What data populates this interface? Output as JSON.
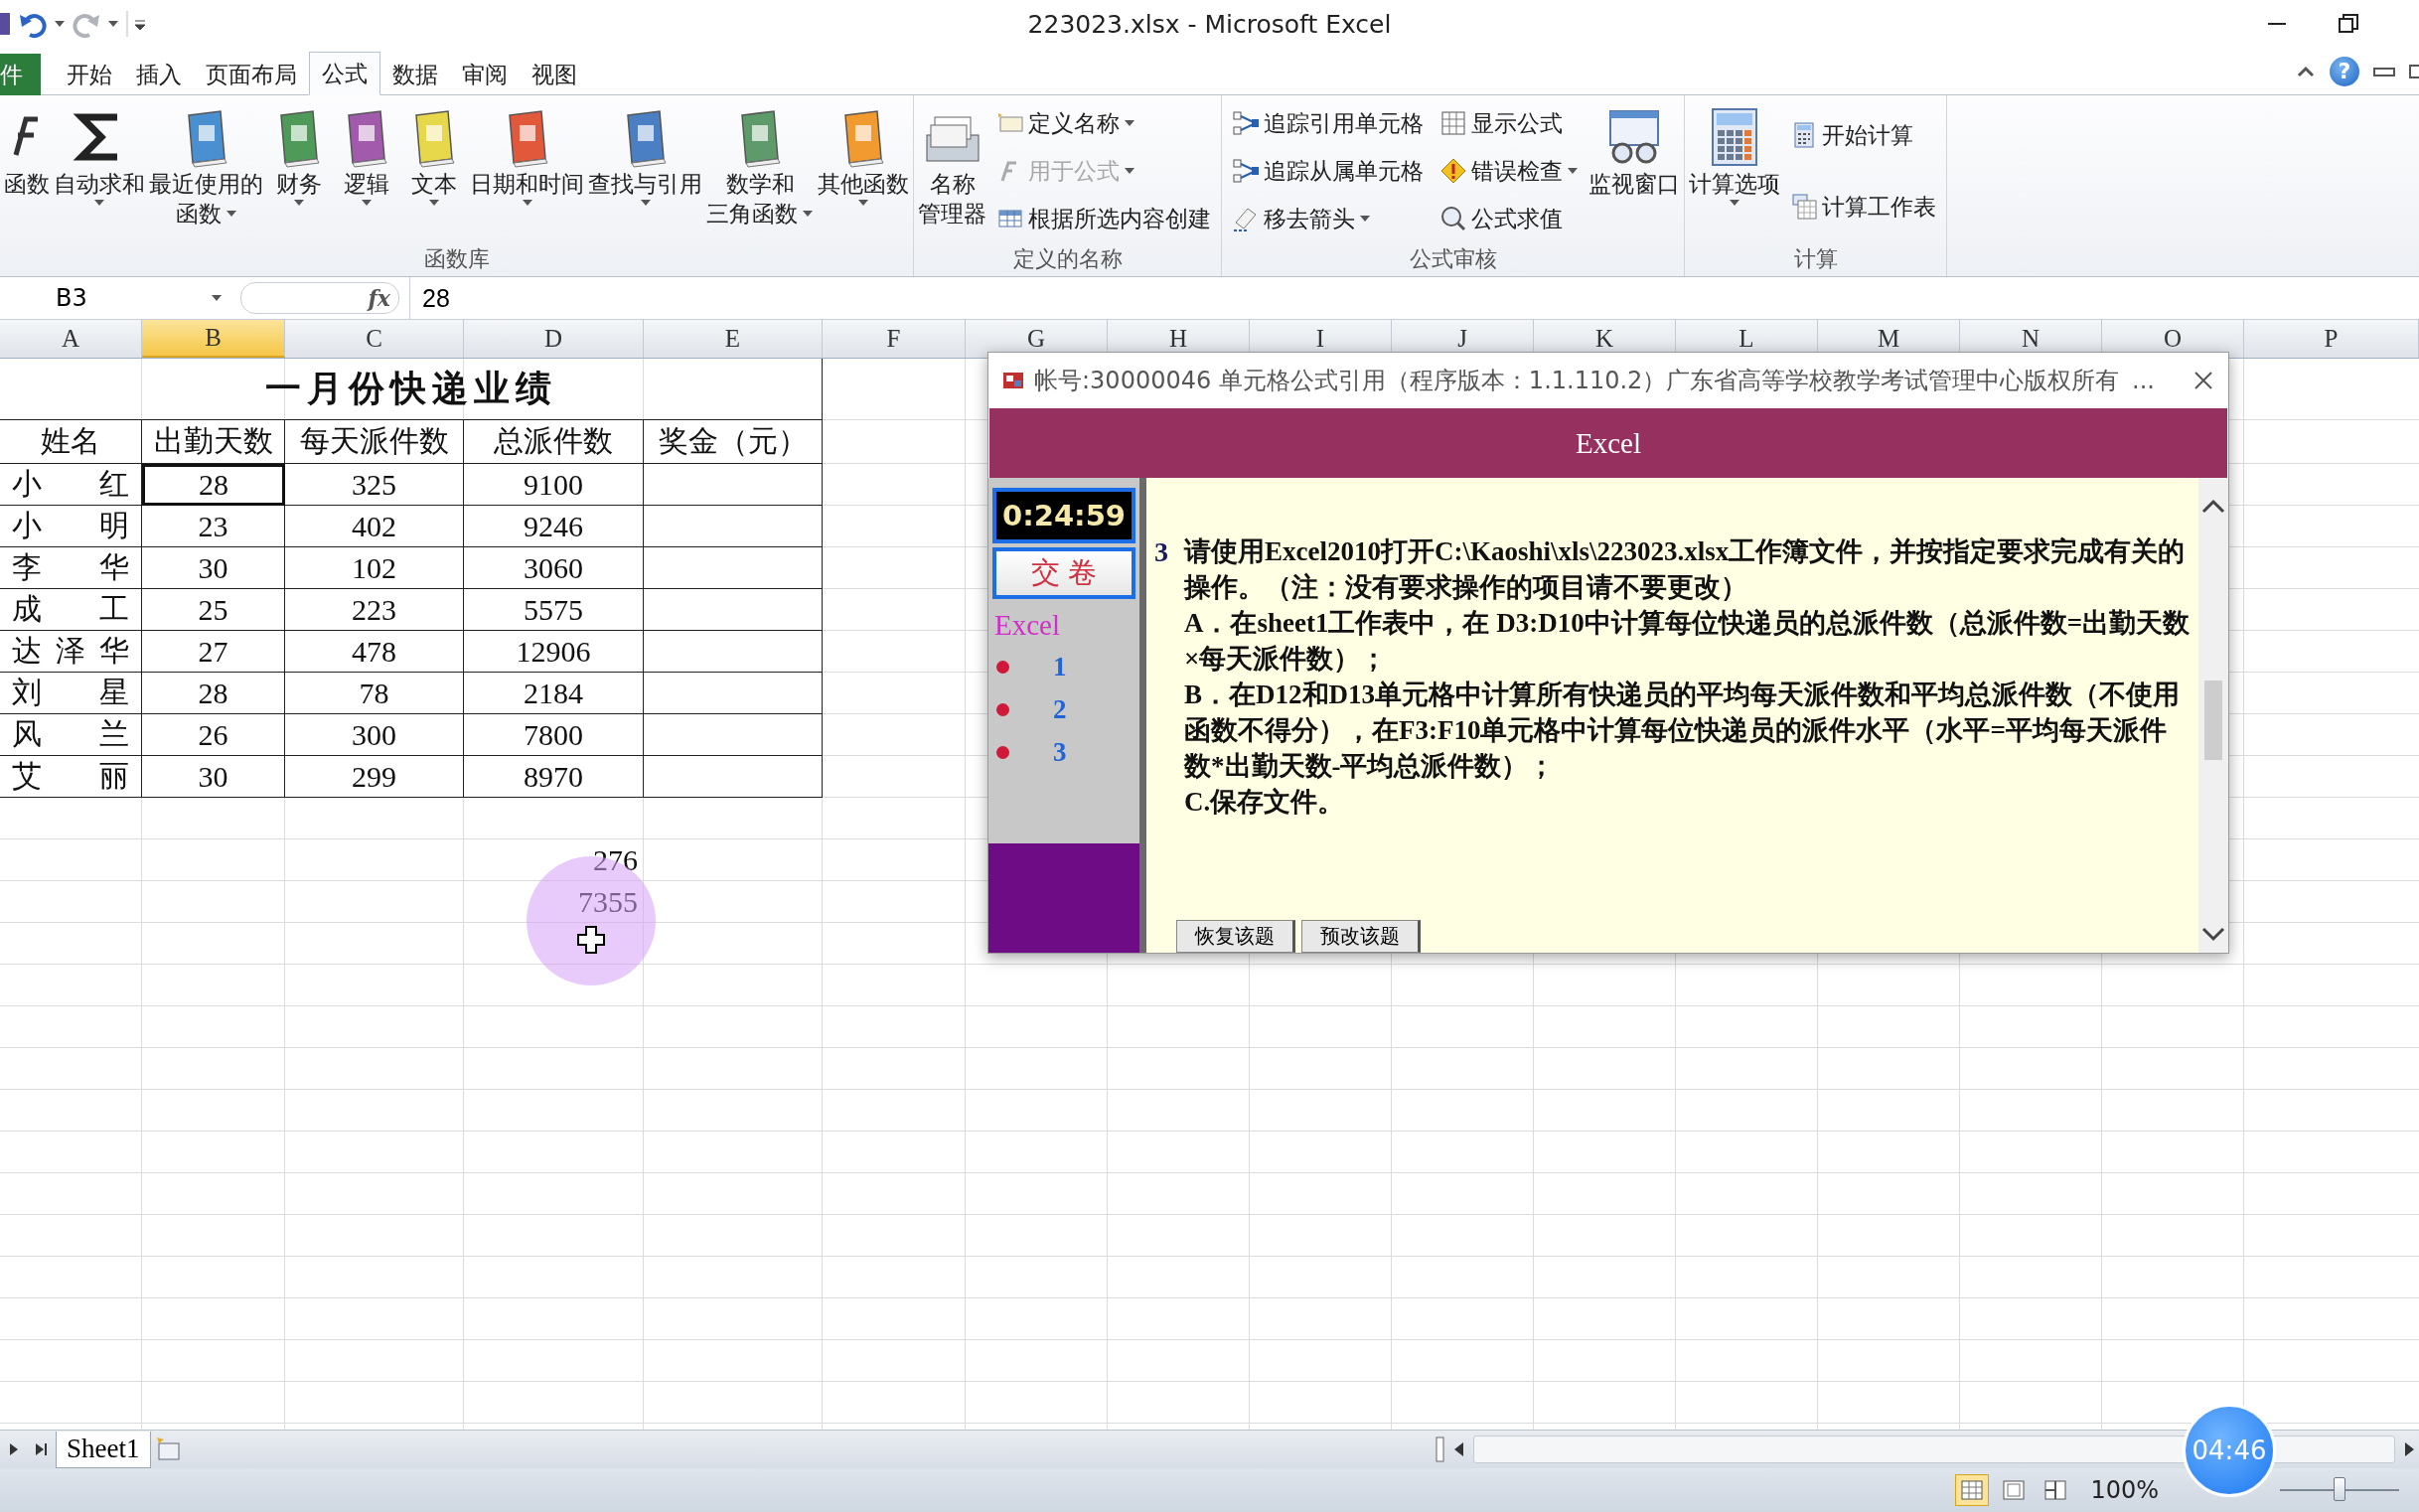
{
  "window": {
    "title": "223023.xlsx - Microsoft Excel",
    "help": "?"
  },
  "tabs": [
    {
      "label": "件",
      "kind": "file",
      "selected": false
    },
    {
      "label": "开始",
      "kind": "tab",
      "selected": false
    },
    {
      "label": "插入",
      "kind": "tab",
      "selected": false
    },
    {
      "label": "页面布局",
      "kind": "tab",
      "selected": false
    },
    {
      "label": "公式",
      "kind": "tab",
      "selected": true
    },
    {
      "label": "数据",
      "kind": "tab",
      "selected": false
    },
    {
      "label": "审阅",
      "kind": "tab",
      "selected": false
    },
    {
      "label": "视图",
      "kind": "tab",
      "selected": false
    }
  ],
  "ribbon": {
    "groups": [
      {
        "label": "函数库",
        "items": [
          {
            "kind": "fx",
            "lines": [
              "函数"
            ],
            "dropdown": false
          },
          {
            "kind": "sigma",
            "lines": [
              "自动求和"
            ],
            "dropdown": true
          },
          {
            "kind": "book",
            "lines": [
              "最近使用的",
              "函数"
            ],
            "color": "#4a8fd0",
            "dropdown": true
          },
          {
            "kind": "book",
            "lines": [
              "财务"
            ],
            "color": "#4f9a58",
            "dropdown": true
          },
          {
            "kind": "book",
            "lines": [
              "逻辑"
            ],
            "color": "#a25aac",
            "dropdown": true
          },
          {
            "kind": "book",
            "lines": [
              "文本"
            ],
            "color": "#e6d84a",
            "dropdown": true
          },
          {
            "kind": "book",
            "lines": [
              "日期和时间"
            ],
            "color": "#e2583a",
            "dropdown": true
          },
          {
            "kind": "book",
            "lines": [
              "查找与引用"
            ],
            "color": "#4a7fc4",
            "dropdown": true
          },
          {
            "kind": "book",
            "lines": [
              "数学和",
              "三角函数"
            ],
            "color": "#5f9a6a",
            "dropdown": true
          },
          {
            "kind": "book",
            "lines": [
              "其他函数"
            ],
            "color": "#f09a30",
            "dropdown": true
          }
        ]
      },
      {
        "label": "定义的名称",
        "items": [
          {
            "kind": "cards",
            "lines": [
              "名称",
              "管理器"
            ],
            "dropdown": false
          },
          {
            "kind": "stack",
            "buttons": [
              {
                "label": "定义名称",
                "kind": "tag",
                "dropdown": true,
                "disabled": false
              },
              {
                "label": "用于公式",
                "kind": "fx",
                "dropdown": true,
                "disabled": true
              },
              {
                "label": "根据所选内容创建",
                "kind": "table",
                "dropdown": false,
                "disabled": false
              }
            ]
          }
        ]
      },
      {
        "label": "公式审核",
        "items": [
          {
            "kind": "stack",
            "buttons": [
              {
                "label": "追踪引用单元格",
                "kind": "trace",
                "dropdown": false,
                "disabled": false
              },
              {
                "label": "追踪从属单元格",
                "kind": "trace",
                "dropdown": false,
                "disabled": false
              },
              {
                "label": "移去箭头",
                "kind": "eraser",
                "dropdown": true,
                "disabled": false
              }
            ]
          },
          {
            "kind": "stack",
            "buttons": [
              {
                "label": "显示公式",
                "kind": "grid",
                "dropdown": false,
                "disabled": false
              },
              {
                "label": "错误检查",
                "kind": "warning",
                "dropdown": true,
                "disabled": false
              },
              {
                "label": "公式求值",
                "kind": "magnifier",
                "dropdown": false,
                "disabled": false
              }
            ]
          },
          {
            "kind": "glasses",
            "lines": [
              "监视窗口"
            ],
            "dropdown": false
          }
        ]
      },
      {
        "label": "计算",
        "items": [
          {
            "kind": "calculator",
            "lines": [
              "计算选项"
            ],
            "dropdown": true
          },
          {
            "kind": "stack",
            "buttons": [
              {
                "label": "开始计算",
                "kind": "calculator",
                "dropdown": false,
                "disabled": false
              },
              {
                "label": "计算工作表",
                "kind": "sheet",
                "dropdown": false,
                "disabled": false
              }
            ]
          }
        ]
      }
    ]
  },
  "formula_bar": {
    "name_box": "B3",
    "function_button": "fx",
    "value": "28"
  },
  "sheet": {
    "columns": [
      {
        "label": "A",
        "selected": false
      },
      {
        "label": "B",
        "selected": true
      },
      {
        "label": "C",
        "selected": false
      },
      {
        "label": "D",
        "selected": false
      },
      {
        "label": "E",
        "selected": false
      },
      {
        "label": "F",
        "selected": false
      },
      {
        "label": "G",
        "selected": false
      },
      {
        "label": "H",
        "selected": false
      },
      {
        "label": "I",
        "selected": false
      },
      {
        "label": "J",
        "selected": false
      },
      {
        "label": "K",
        "selected": false
      },
      {
        "label": "L",
        "selected": false
      },
      {
        "label": "M",
        "selected": false
      },
      {
        "label": "N",
        "selected": false
      },
      {
        "label": "O",
        "selected": false
      },
      {
        "label": "P",
        "selected": false
      }
    ],
    "title": "一月份快递业绩",
    "header": [
      "姓名",
      "出勤天数",
      "每天派件数",
      "总派件数",
      "奖金（元）"
    ],
    "rows": [
      {
        "cells": [
          "小 红",
          "28",
          "325",
          "9100"
        ],
        "selected": true
      },
      {
        "cells": [
          "小 明",
          "23",
          "402",
          "9246"
        ],
        "selected": false
      },
      {
        "cells": [
          "李 华",
          "30",
          "102",
          "3060"
        ],
        "selected": false
      },
      {
        "cells": [
          "成 工",
          "25",
          "223",
          "5575"
        ],
        "selected": false
      },
      {
        "cells": [
          "达泽华",
          "27",
          "478",
          "12906"
        ],
        "selected": false
      },
      {
        "cells": [
          "刘 星",
          "28",
          "78",
          "2184"
        ],
        "selected": false
      },
      {
        "cells": [
          "风 兰",
          "26",
          "300",
          "7800"
        ],
        "selected": false
      },
      {
        "cells": [
          "艾 丽",
          "30",
          "299",
          "8970"
        ],
        "selected": false
      }
    ],
    "summary_cells": [
      "276",
      "7355"
    ]
  },
  "sheet_tabs": [
    {
      "label": "Sheet1",
      "selected": true
    }
  ],
  "status_bar": {
    "views": [
      {
        "kind": "normal",
        "selected": true
      },
      {
        "kind": "page_layout",
        "selected": false
      },
      {
        "kind": "page_break",
        "selected": false
      }
    ],
    "zoom": "100%",
    "zoom_slider": {
      "level": 0.5
    }
  },
  "dialog": {
    "title": "帐号:30000046  单元格公式引用（程序版本：1.1.110.2）广东省高等学校教学考试管理中心版权所有",
    "more": "...",
    "header": "Excel",
    "timer": "0:24:59",
    "submit": "交 卷",
    "section": "Excel",
    "questions": [
      "1",
      "2",
      "3"
    ],
    "question": {
      "number": "3",
      "paragraphs": [
        "请使用Excel2010打开C:\\Kaoshi\\xls\\223023.xlsx工作簿文件，并按指定要求完成有关的操作。（注：没有要求操作的项目请不要更改）",
        "A．在sheet1工作表中，在 D3:D10中计算每位快递员的总派件数（总派件数=出勤天数×每天派件数）；",
        "B．在D12和D13单元格中计算所有快递员的平均每天派件数和平均总派件数（不使用函数不得分），在F3:F10单元格中计算每位快递员的派件水平（水平=平均每天派件数*出勤天数-平均总派件数）；",
        "C.保存文件。"
      ]
    },
    "buttons": [
      "恢复该题",
      "预改该题"
    ]
  },
  "recording_timer": "04:46"
}
